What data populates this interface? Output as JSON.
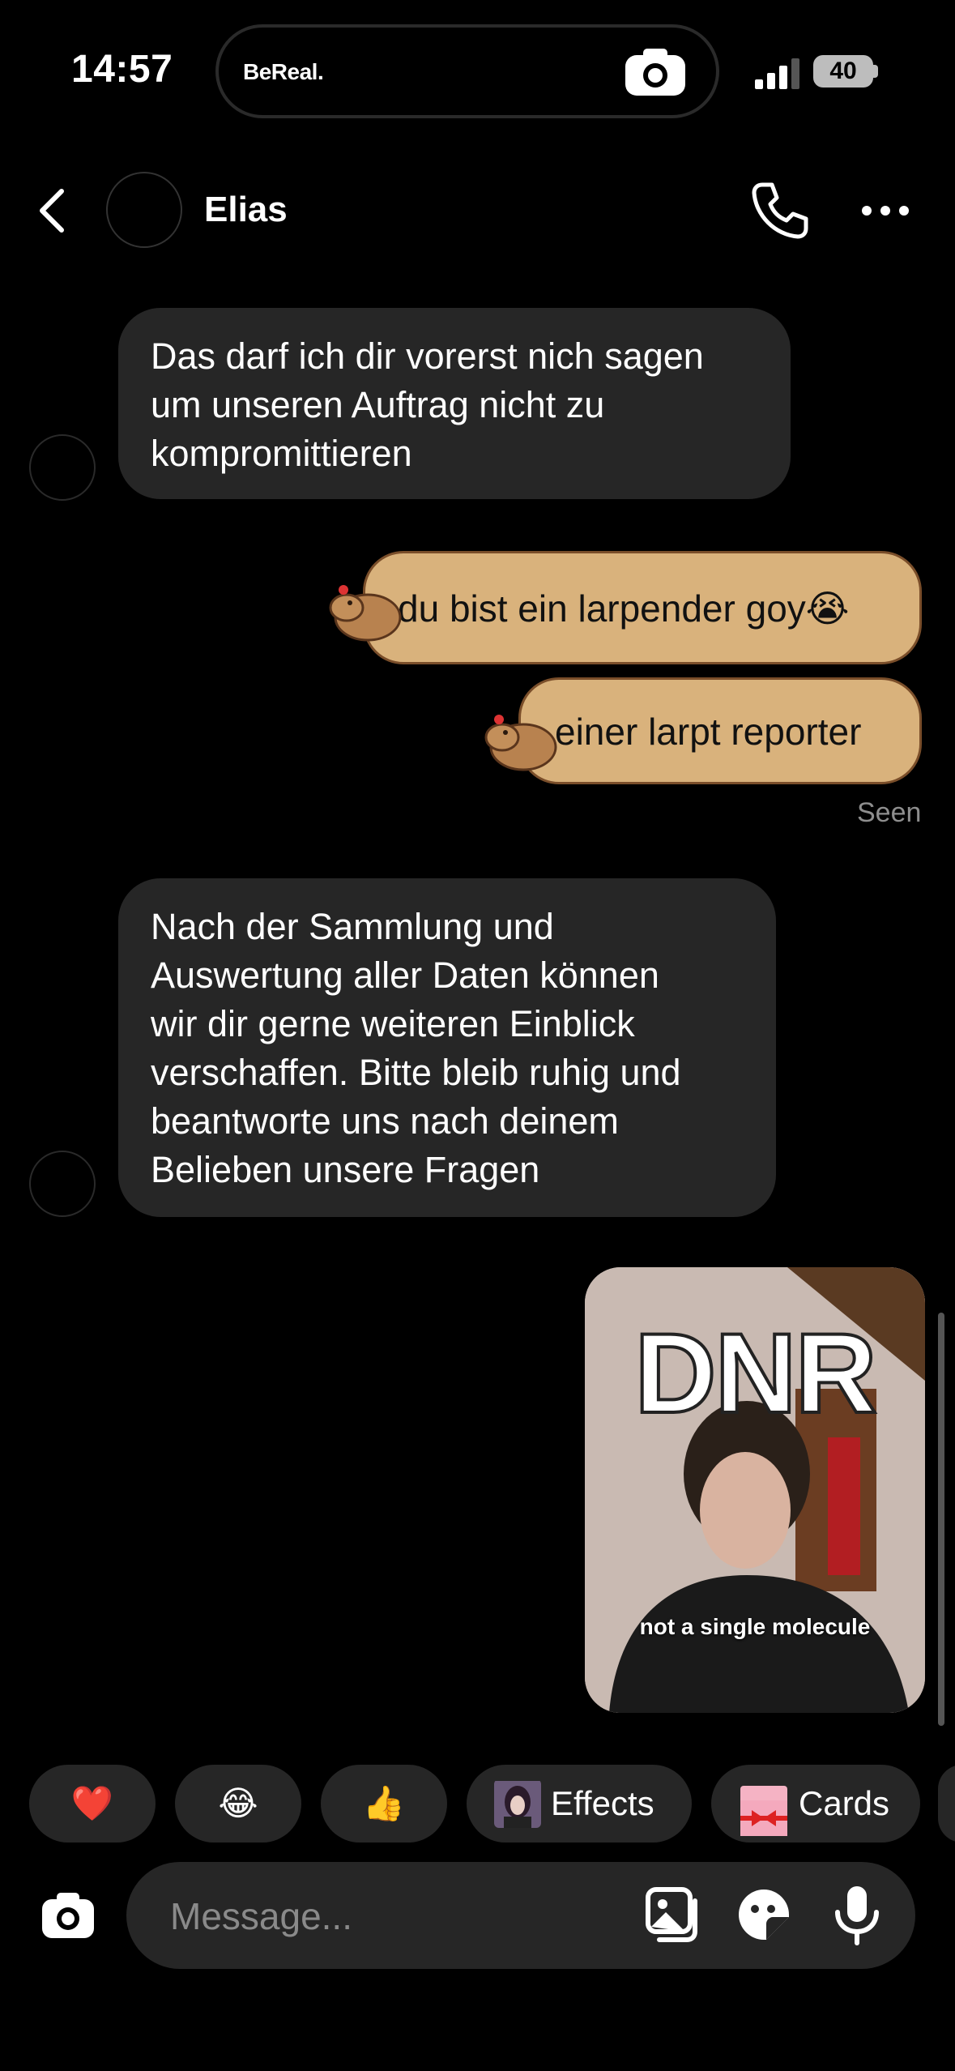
{
  "status_bar": {
    "time": "14:57",
    "island_app": "BeReal.",
    "battery": "40"
  },
  "header": {
    "contact_name": "Elias"
  },
  "messages": [
    {
      "direction": "incoming",
      "text": "Das darf ich dir vorerst nich sagen\num unseren Auftrag nicht zu\nkompromittieren"
    },
    {
      "direction": "outgoing",
      "text": "du bist ein larpender goy😭"
    },
    {
      "direction": "outgoing",
      "text": "einer larpt reporter"
    },
    {
      "direction": "incoming",
      "text": "Nach der Sammlung und\nAuswertung aller Daten können\nwir dir gerne weiteren Einblick\nverschaffen. Bitte bleib ruhig und\nbeantworte uns nach deinem\nBelieben unsere Fragen"
    }
  ],
  "seen_label": "Seen",
  "photo_message": {
    "title": "DNR",
    "caption": "not a single molecule"
  },
  "quick_reactions": {
    "heart": "❤️",
    "laugh": "😂",
    "thumbs_up": "👍",
    "effects_label": "Effects",
    "cards_label": "Cards"
  },
  "composer": {
    "placeholder": "Message..."
  },
  "colors": {
    "incoming_bubble": "#262626",
    "outgoing_bubble": "#d9b27c",
    "background": "#000000"
  }
}
